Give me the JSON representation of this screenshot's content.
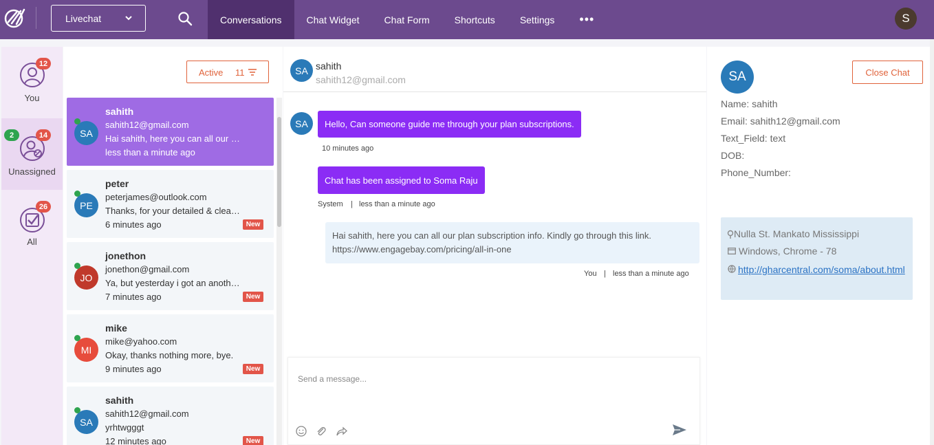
{
  "topbar": {
    "channel": "Livechat",
    "nav": [
      {
        "label": "Conversations",
        "active": true
      },
      {
        "label": "Chat Widget",
        "active": false
      },
      {
        "label": "Chat Form",
        "active": false
      },
      {
        "label": "Shortcuts",
        "active": false
      },
      {
        "label": "Settings",
        "active": false
      }
    ],
    "more": "•••",
    "user_initial": "S"
  },
  "filters": {
    "you": {
      "label": "You",
      "count": "12"
    },
    "unassigned": {
      "label": "Unassigned",
      "count": "14",
      "green_count": "2"
    },
    "all": {
      "label": "All",
      "count": "26"
    }
  },
  "conversation_list": {
    "filter_label": "Active",
    "filter_count": "11",
    "items": [
      {
        "name": "sahith",
        "email": "sahith12@gmail.com",
        "message": "Hai sahith, here you can all our plan subscription info.",
        "time": "less than a minute ago",
        "initials": "SA",
        "color": "#2a7ab8",
        "new": false,
        "selected": true
      },
      {
        "name": "peter",
        "email": "peterjames@outlook.com",
        "message": "Thanks, for your detailed & clear info.",
        "time": "6 minutes ago",
        "initials": "PE",
        "color": "#2a7ab8",
        "new": true,
        "selected": false
      },
      {
        "name": "jonethon",
        "email": "jonethon@gmail.com",
        "message": "Ya, but yesterday i got an another query.",
        "time": "7 minutes ago",
        "initials": "JO",
        "color": "#c0392b",
        "new": true,
        "selected": false
      },
      {
        "name": "mike",
        "email": "mike@yahoo.com",
        "message": "Okay, thanks nothing more, bye.",
        "time": "9 minutes ago",
        "initials": "MI",
        "color": "#e74c3c",
        "new": true,
        "selected": false
      },
      {
        "name": "sahith",
        "email": "sahith12@gmail.com",
        "message": "yrhtwgggt",
        "time": "12 minutes ago",
        "initials": "SA",
        "color": "#2a7ab8",
        "new": true,
        "selected": false
      }
    ],
    "new_label": "New"
  },
  "chat": {
    "header_name": "sahith",
    "header_email": "sahith12@gmail.com",
    "initials": "SA",
    "msg1": "Hello, Can someone guide me through your plan subscriptions.",
    "msg1_time": "10 minutes ago",
    "msg2": "Chat has been assigned to Soma Raju",
    "msg2_sender": "System",
    "msg2_sep": "|",
    "msg2_time": "less than a minute ago",
    "msg3": "Hai sahith, here you can all our plan subscription info. Kindly go through this link. https://www.engagebay.com/pricing/all-in-one",
    "msg3_sender": "You",
    "msg3_sep": "|",
    "msg3_time": "less than a minute ago",
    "composer_placeholder": "Send a message..."
  },
  "info": {
    "initials": "SA",
    "close_label": "Close Chat",
    "fields": [
      "Name: sahith",
      "Email: sahith12@gmail.com",
      "Text_Field: text",
      "DOB:",
      "Phone_Number:"
    ],
    "location": "Nulla St. Mankato Mississippi",
    "browser": "Windows, Chrome - 78",
    "url": "http://gharcentral.com/soma/about.html"
  },
  "colors": {
    "topbar": "#6c4a8e",
    "nav_active": "#50306e",
    "selected_conv": "#9f6be4",
    "bubble_in": "#8b2cf5",
    "accent_orange": "#e0623a"
  }
}
